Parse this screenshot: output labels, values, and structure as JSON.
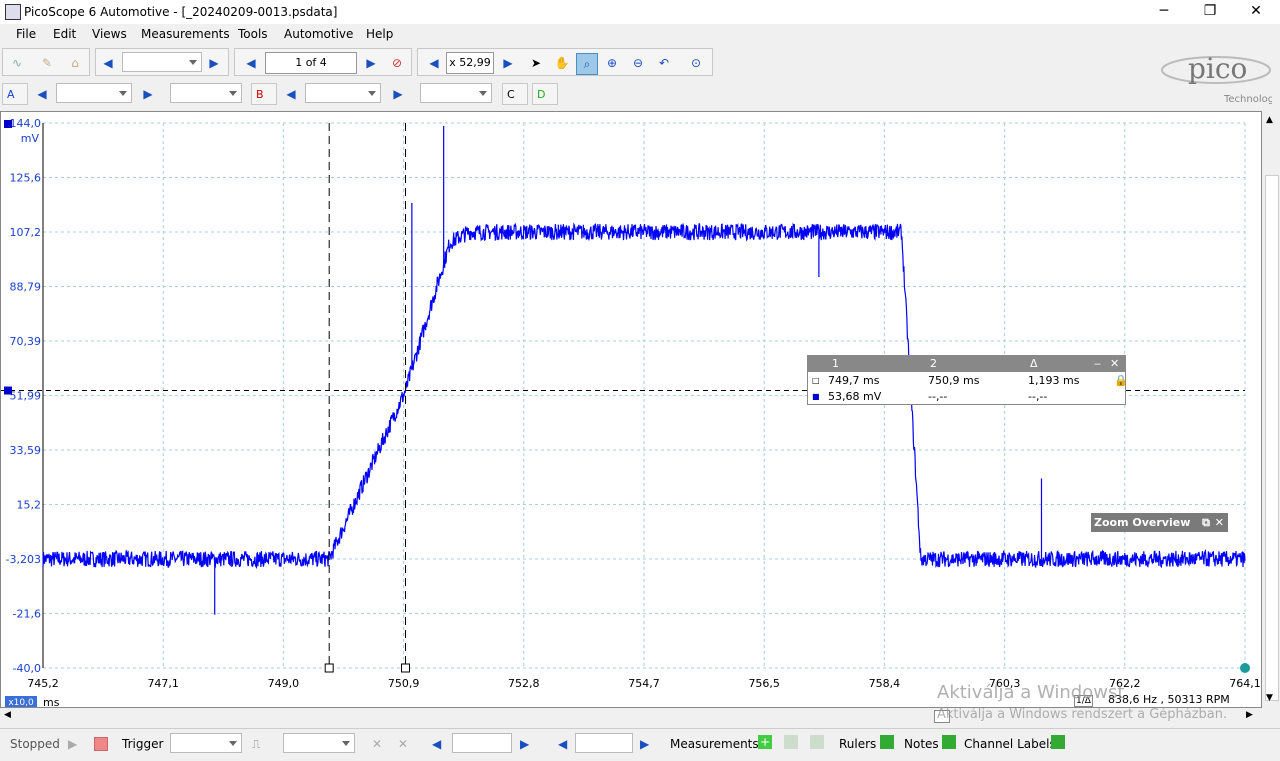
{
  "window": {
    "title": "PicoScope 6 Automotive - [_20240209-0013.psdata]",
    "minimize": "─",
    "restore": "❐",
    "close": "✕"
  },
  "menu": [
    "File",
    "Edit",
    "Views",
    "Measurements",
    "Tools",
    "Automotive",
    "Help"
  ],
  "toolbar1": {
    "buffer": "1 of 4",
    "zoom": "x 52,99"
  },
  "toolbar2": {
    "ch_a": "A",
    "ch_b": "B",
    "ch_c": "C",
    "ch_d": "D"
  },
  "logo": {
    "brand": "pico",
    "sub": "Technology"
  },
  "scope": {
    "y_unit": "mV",
    "y_ticks": [
      "144,0",
      "125,6",
      "107,2",
      "88,79",
      "70,39",
      "51,99",
      "33,59",
      "15,2",
      "-3,203",
      "-21,6",
      "-40,0"
    ],
    "x_ticks": [
      "745,2",
      "747,1",
      "749,0",
      "750,9",
      "752,8",
      "754,7",
      "756,5",
      "758,4",
      "760,3",
      "762,2",
      "764,1"
    ],
    "x_unit": "ms",
    "x_zoom": "x10,0"
  },
  "rulers": {
    "headers": [
      "1",
      "2",
      "Δ"
    ],
    "time_row": [
      "749,7 ms",
      "750,9 ms",
      "1,193 ms"
    ],
    "volt_row": [
      "53,68 mV",
      "--,--",
      "--,--"
    ]
  },
  "zoom_overview": "Zoom Overview",
  "freq": {
    "prefix": "1/Δ",
    "value": "838,6 Hz , 50313 RPM"
  },
  "watermark": {
    "line1": "Aktiválja a Windowst",
    "line2": "Aktiválja a Windows rendszert a Gépházban."
  },
  "status": {
    "stopped": "Stopped",
    "trigger": "Trigger",
    "measurements": "Measurements",
    "rulers": "Rulers",
    "notes": "Notes",
    "channel_labels": "Channel Labels"
  },
  "colors": {
    "trace": "#0000ff",
    "axis_text": "#1a3fd0",
    "grid": "#a9cfe0"
  }
}
